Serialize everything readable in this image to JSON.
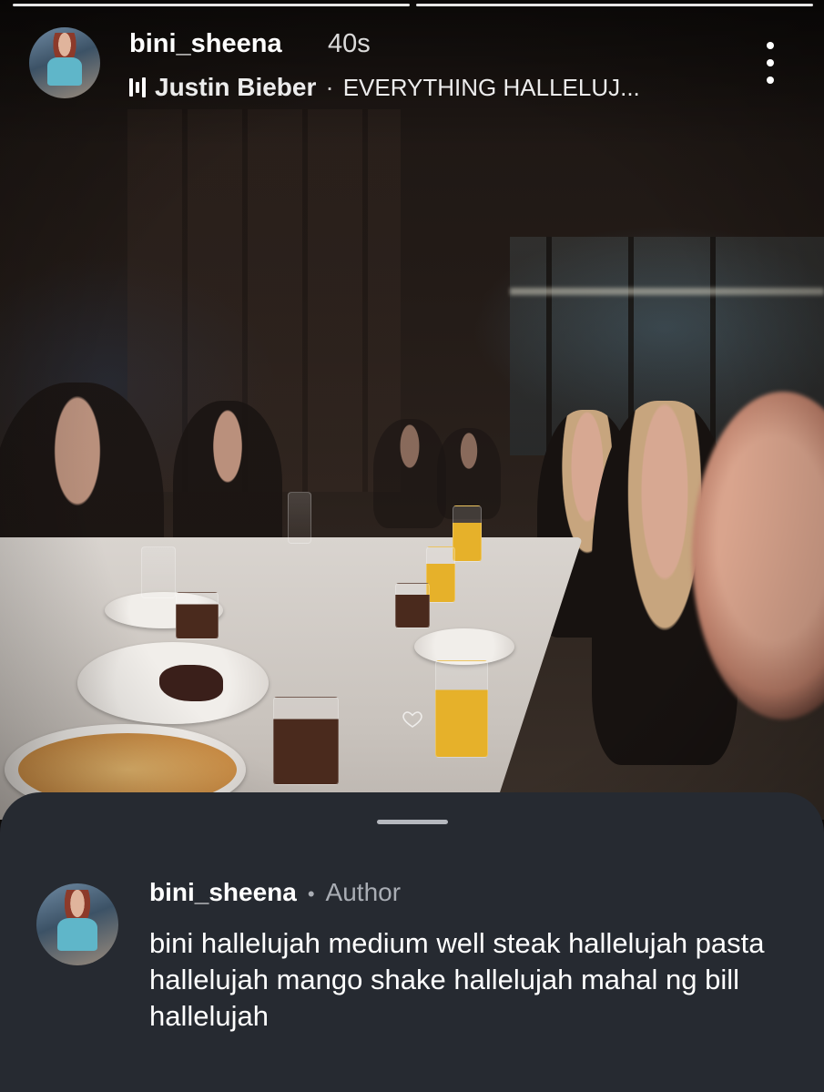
{
  "story": {
    "username": "bini_sheena",
    "time_ago": "40s",
    "music": {
      "artist": "Justin Bieber",
      "separator": "·",
      "title": "EVERYTHING HALLELUJ..."
    },
    "progress_segments": 2,
    "more_icon": "more-vertical-icon"
  },
  "comment_sheet": {
    "comment": {
      "username": "bini_sheena",
      "separator": "•",
      "role": "Author",
      "text": "bini hallelujah medium well steak hallelujah pasta hallelujah mango shake hallelujah mahal ng bill hallelujah"
    }
  },
  "colors": {
    "sheet_background": "#262a31",
    "secondary_text": "#a9adb4",
    "primary_text": "#ffffff"
  }
}
